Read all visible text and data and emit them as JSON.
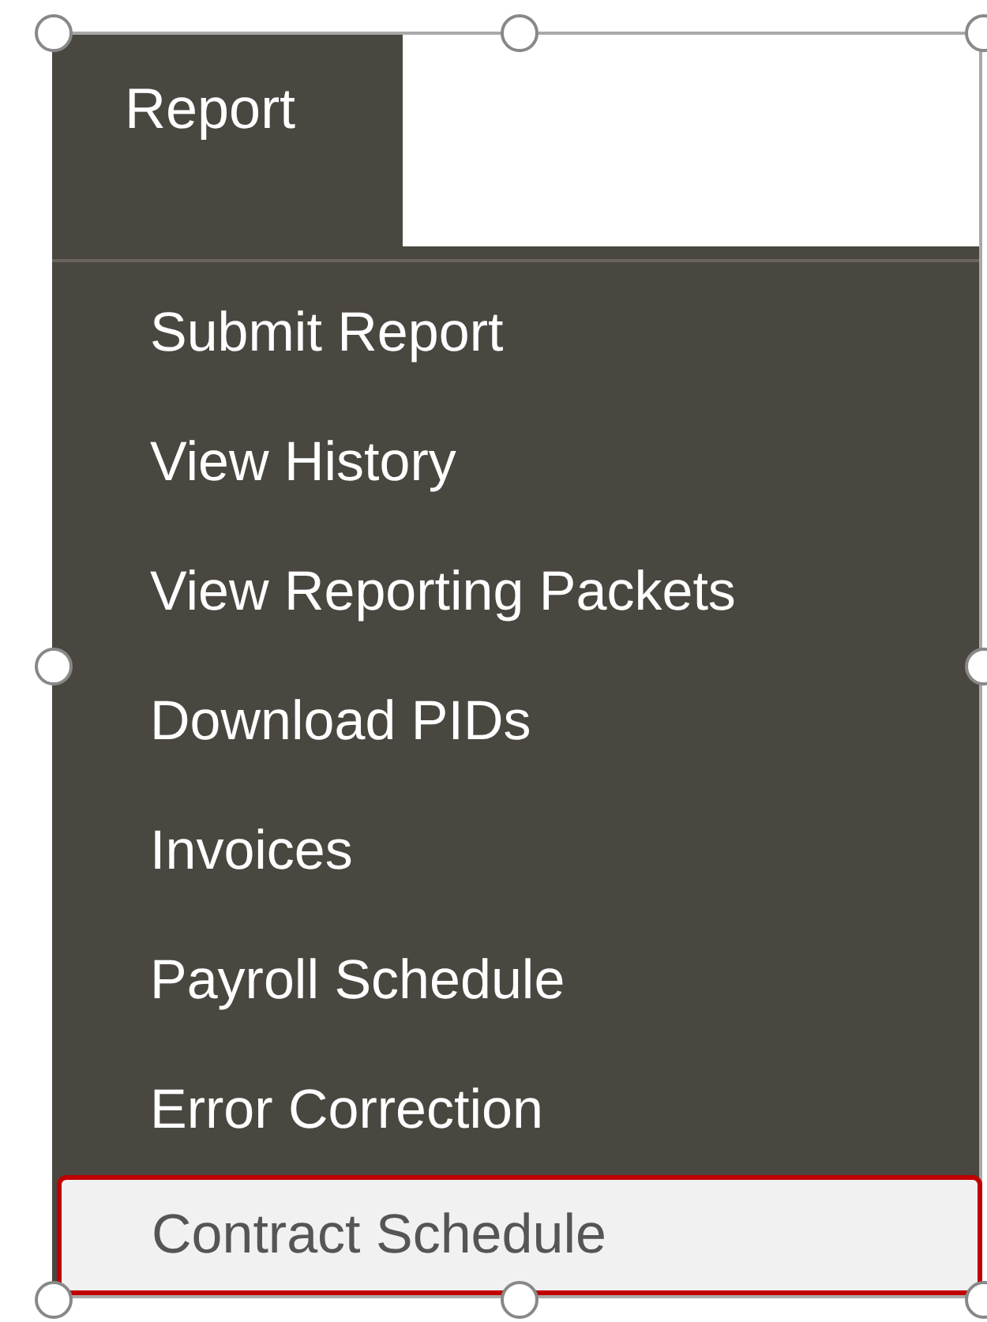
{
  "tab": {
    "label": "Report"
  },
  "items": [
    {
      "label": "Submit Report",
      "selected": false
    },
    {
      "label": "View History",
      "selected": false
    },
    {
      "label": "View Reporting Packets",
      "selected": false
    },
    {
      "label": "Download PIDs",
      "selected": false
    },
    {
      "label": "Invoices",
      "selected": false
    },
    {
      "label": "Payroll Schedule",
      "selected": false
    },
    {
      "label": "Error Correction",
      "selected": false
    },
    {
      "label": "Contract Schedule",
      "selected": true
    }
  ]
}
